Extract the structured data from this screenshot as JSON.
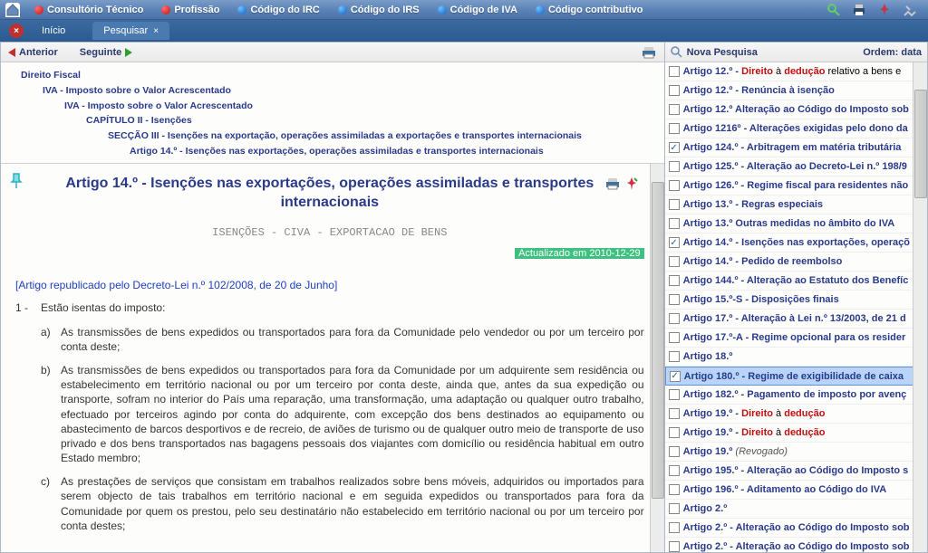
{
  "toolbar": {
    "items": [
      {
        "label": "Consultório Técnico",
        "dot": "red"
      },
      {
        "label": "Profissão",
        "dot": "red"
      },
      {
        "label": "Código do IRC",
        "dot": "blue"
      },
      {
        "label": "Código do IRS",
        "dot": "blue"
      },
      {
        "label": "Código de IVA",
        "dot": "blue"
      },
      {
        "label": "Código contributivo",
        "dot": "blue"
      }
    ]
  },
  "subbar": {
    "home": "Início",
    "tab": "Pesquisar",
    "tab_close": "×"
  },
  "nav": {
    "prev": "Anterior",
    "next": "Seguinte"
  },
  "breadcrumb": [
    "Direito Fiscal",
    "IVA - Imposto sobre o Valor Acrescentado",
    "IVA - Imposto sobre o Valor Acrescentado",
    "CAPÍTULO II - Isenções",
    "SECÇÃO III - Isenções na exportação, operações assimiladas a exportações e transportes internacionais",
    "Artigo 14.º - Isenções nas exportações, operações assimiladas e transportes internacionais"
  ],
  "article": {
    "title": "Artigo 14.º - Isenções nas exportações, operações assimiladas e transportes internacionais",
    "keywords": "ISENÇÕES - CIVA - EXPORTACAO DE BENS",
    "updated": "Actualizado em 2010-12-29",
    "republished": "[Artigo republicado pelo Decreto-Lei n.º 102/2008, de 20 de Junho]",
    "section1_num": "1 -",
    "section1_label": "Estão isentas do imposto:",
    "items": [
      {
        "l": "a)",
        "t": "As transmissões de bens expedidos ou transportados para fora da Comunidade pelo vendedor ou por um terceiro por conta deste;"
      },
      {
        "l": "b)",
        "t": "As transmissões de bens expedidos ou transportados para fora da Comunidade por um adquirente sem residência ou estabelecimento em território nacional ou por um terceiro por conta deste, ainda que, antes da sua expedição ou transporte, sofram no interior do País uma reparação, uma transformação, uma adaptação ou qualquer outro trabalho, efectuado por terceiros agindo por conta do adquirente, com excepção dos bens destinados ao equipamento ou abastecimento de barcos desportivos e de recreio, de aviões de turismo ou de qualquer outro meio de transporte de uso privado e dos bens transportados nas bagagens pessoais dos viajantes com domicílio ou residência habitual em outro Estado membro;"
      },
      {
        "l": "c)",
        "t": "As prestações de serviços que consistam em trabalhos realizados sobre bens móveis, adquiridos ou importados para serem objecto de tais trabalhos em território nacional e em seguida expedidos ou transportados para fora da Comunidade por quem os prestou, pelo seu destinatário não estabelecido em território nacional ou por um terceiro por conta destes;"
      }
    ]
  },
  "search": {
    "title": "Nova Pesquisa",
    "order_label": "Ordem: data",
    "hl_direito": "Direito",
    "hl_deducao": "dedução",
    "a_word": "à",
    "results": [
      {
        "chk": false,
        "pre": "Artigo 12.º - ",
        "hl": true,
        "post": " relativo a bens e"
      },
      {
        "chk": false,
        "txt": "Artigo 12.º - Renúncia à isenção"
      },
      {
        "chk": false,
        "txt": "Artigo 12.º Alteração ao Código do Imposto sob"
      },
      {
        "chk": false,
        "txt": "Artigo 1216º - Alterações exigidas pelo dono da"
      },
      {
        "chk": true,
        "txt": "Artigo 124.º - Arbitragem em matéria tributária"
      },
      {
        "chk": false,
        "txt": "Artigo 125.º - Alteração ao Decreto-Lei n.º 198/9"
      },
      {
        "chk": false,
        "txt": "Artigo 126.º - Regime fiscal para residentes não"
      },
      {
        "chk": false,
        "txt": "Artigo 13.º - Regras especiais"
      },
      {
        "chk": false,
        "txt": "Artigo 13.º Outras medidas no âmbito do IVA"
      },
      {
        "chk": true,
        "txt": "Artigo 14.º - Isenções nas exportações, operaçõ"
      },
      {
        "chk": false,
        "txt": "Artigo 14.º - Pedido de reembolso"
      },
      {
        "chk": false,
        "txt": "Artigo 144.º - Alteração ao Estatuto dos Benefíc"
      },
      {
        "chk": false,
        "txt": "Artigo 15.º-S - Disposições finais"
      },
      {
        "chk": false,
        "txt": "Artigo 17.º - Alteração à Lei n.º 13/2003, de 21 d"
      },
      {
        "chk": false,
        "txt": "Artigo 17.º-A - Regime opcional para os resider"
      },
      {
        "chk": false,
        "txt": "Artigo 18.º"
      },
      {
        "chk": true,
        "txt": "Artigo 180.º - Regime de exigibilidade de caixa",
        "selected": true
      },
      {
        "chk": false,
        "txt": "Artigo 182.º - Pagamento de imposto por avenç"
      },
      {
        "chk": false,
        "pre": "Artigo 19.º - ",
        "hl": true,
        "post": ""
      },
      {
        "chk": false,
        "pre": "Artigo 19.º - ",
        "hl": true,
        "post": ""
      },
      {
        "chk": false,
        "pre": "Artigo 19.º ",
        "italic": "(Revogado)"
      },
      {
        "chk": false,
        "txt": "Artigo 195.º - Alteração ao Código do Imposto s"
      },
      {
        "chk": false,
        "txt": "Artigo 196.º - Aditamento ao Código do IVA"
      },
      {
        "chk": false,
        "txt": "Artigo 2.º"
      },
      {
        "chk": false,
        "txt": "Artigo 2.º - Alteração ao Código do Imposto sob"
      },
      {
        "chk": false,
        "txt": "Artigo 2.º - Alteração ao Código do Imposto sob"
      }
    ]
  }
}
